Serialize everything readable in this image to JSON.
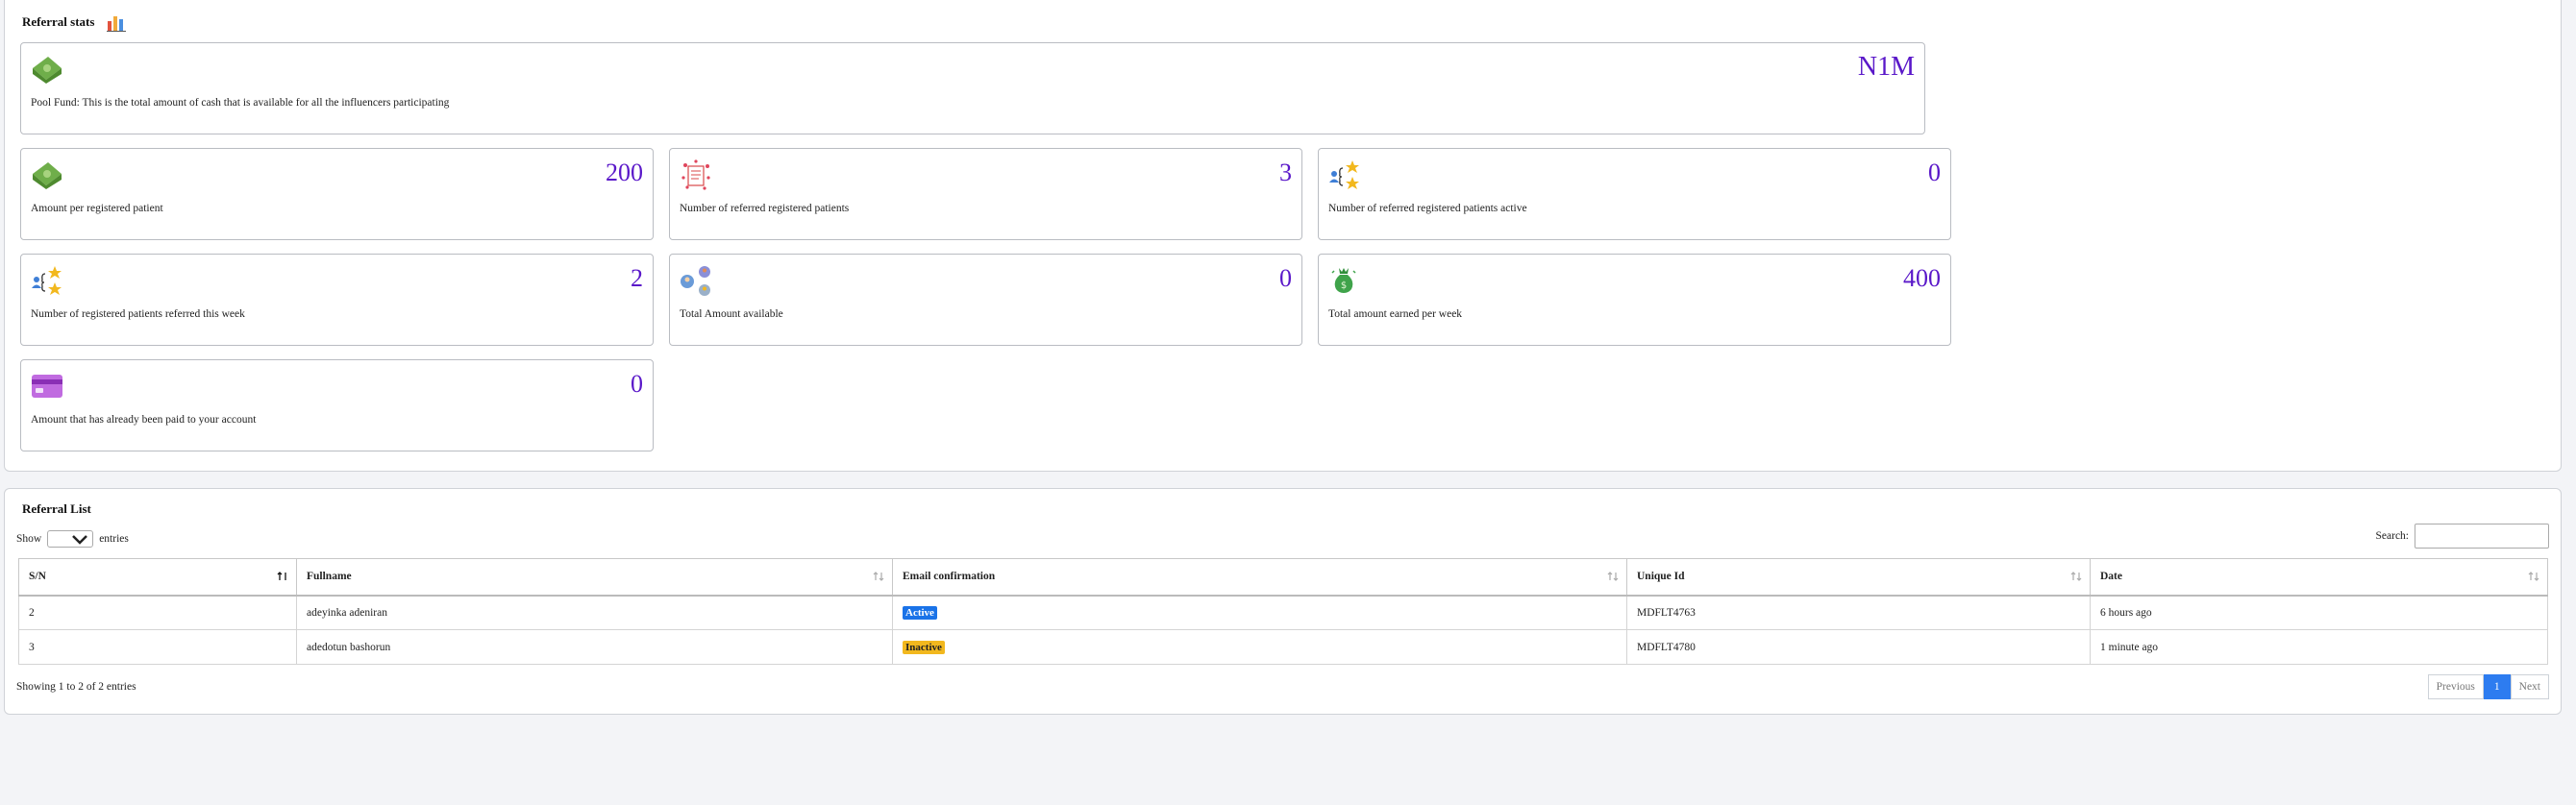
{
  "stats": {
    "title": "Referral stats",
    "pool": {
      "value": "N1M",
      "desc": "Pool Fund: This is the total amount of cash that is available for all the influencers participating"
    },
    "cards": [
      {
        "value": "200",
        "desc": "Amount per registered patient",
        "icon": "cash-icon"
      },
      {
        "value": "3",
        "desc": "Number of referred registered patients",
        "icon": "clipboard-icon"
      },
      {
        "value": "0",
        "desc": "Number of referred registered patients active",
        "icon": "user-stars-icon"
      },
      {
        "value": "2",
        "desc": "Number of registered patients referred this week",
        "icon": "user-stars-icon"
      },
      {
        "value": "0",
        "desc": "Total Amount available",
        "icon": "people-network-icon"
      },
      {
        "value": "400",
        "desc": "Total amount earned per week",
        "icon": "money-bag-icon"
      },
      {
        "value": "0",
        "desc": "Amount that has already been paid to your account",
        "icon": "card-icon"
      }
    ]
  },
  "list": {
    "title": "Referral List",
    "show_label": "Show",
    "entries_label": "entries",
    "search_label": "Search:",
    "columns": [
      "S/N",
      "Fullname",
      "Email confirmation",
      "Unique Id",
      "Date"
    ],
    "rows": [
      {
        "sn": "2",
        "fullname": "adeyinka adeniran",
        "status": "Active",
        "uid": "MDFLT4763",
        "date": "6 hours ago"
      },
      {
        "sn": "3",
        "fullname": "adedotun bashorun",
        "status": "Inactive",
        "uid": "MDFLT4780",
        "date": "1 minute ago"
      }
    ],
    "info": "Showing 1 to 2 of 2 entries",
    "pager": {
      "prev": "Previous",
      "page": "1",
      "next": "Next"
    }
  }
}
